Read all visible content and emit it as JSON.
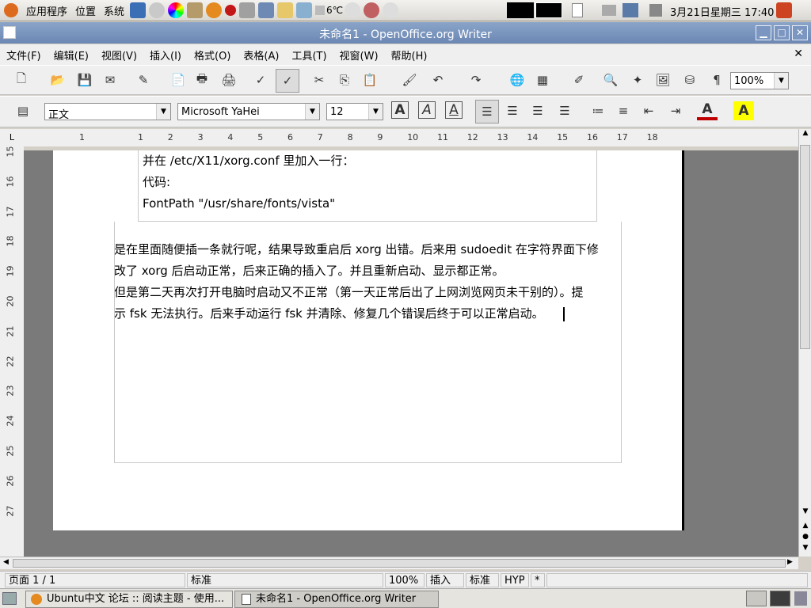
{
  "top_panel": {
    "menus": [
      "应用程序",
      "位置",
      "系统"
    ],
    "weather": "6℃",
    "datetime": "3月21日星期三 17:40"
  },
  "window": {
    "title": "未命名1 - OpenOffice.org Writer",
    "close_doc_glyph": "✕"
  },
  "menubar": [
    "文件(F)",
    "编辑(E)",
    "视图(V)",
    "插入(I)",
    "格式(O)",
    "表格(A)",
    "工具(T)",
    "视窗(W)",
    "帮助(H)"
  ],
  "toolbar": {
    "zoom": "100%",
    "paragraph_mark": "¶"
  },
  "formatting": {
    "style": "正文",
    "font": "Microsoft YaHei",
    "size": "12",
    "bold": "A",
    "italic": "A",
    "underline": "A"
  },
  "ruler": {
    "h_ticks": [
      "1",
      "1",
      "2",
      "3",
      "4",
      "5",
      "6",
      "7",
      "8",
      "9",
      "10",
      "11",
      "12",
      "13",
      "14",
      "15",
      "16",
      "17",
      "18"
    ],
    "v_ticks": [
      "15",
      "16",
      "17",
      "18",
      "19",
      "20",
      "21",
      "22",
      "23",
      "24",
      "25",
      "26",
      "27"
    ]
  },
  "document": {
    "quote_lines": [
      "并在 /etc/X11/xorg.conf 里加入一行：",
      "代码:",
      "FontPath \"/usr/share/fonts/vista\""
    ],
    "body_lines": [
      "是在里面随便插一条就行呢，结果导致重启后 xorg 出错。后来用 sudoedit 在字符界面下修",
      "改了 xorg 后启动正常，后来正确的插入了。并且重新启动、显示都正常。",
      "但是第二天再次打开电脑时启动又不正常（第一天正常后出了上网浏览网页未干别的）。提",
      "示 fsk 无法执行。后来手动运行 fsk 并清除、修复几个错误后终于可以正常启动。"
    ]
  },
  "status": {
    "page": "页面 1 / 1",
    "style": "标准",
    "zoom": "100%",
    "insert": "插入",
    "selection": "标准",
    "hyp": "HYP",
    "modified": "*"
  },
  "taskbar": {
    "tasks": [
      "Ubuntu中文 论坛 :: 阅读主题 - 使用...",
      "未命名1 - OpenOffice.org Writer"
    ]
  },
  "colors": {
    "titlebar": "#7591bd",
    "font_color": "#c00000",
    "highlight": "#ffff00"
  }
}
